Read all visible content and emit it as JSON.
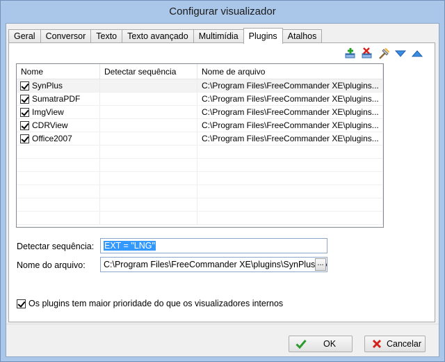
{
  "window": {
    "title": "Configurar visualizador"
  },
  "tabs": [
    {
      "label": "Geral",
      "active": false
    },
    {
      "label": "Conversor",
      "active": false
    },
    {
      "label": "Texto",
      "active": false
    },
    {
      "label": "Texto avançado",
      "active": false
    },
    {
      "label": "Multimídia",
      "active": false
    },
    {
      "label": "Plugins",
      "active": true
    },
    {
      "label": "Atalhos",
      "active": false
    }
  ],
  "toolbar": {
    "icons": [
      "add-plugin-icon",
      "remove-plugin-icon",
      "configure-plugin-icon",
      "move-down-icon",
      "move-up-icon"
    ]
  },
  "list": {
    "columns": [
      "Nome",
      "Detectar sequência",
      "Nome de arquivo"
    ],
    "rows": [
      {
        "checked": true,
        "name": "SynPlus",
        "detect": "",
        "file": "C:\\Program Files\\FreeCommander XE\\plugins..."
      },
      {
        "checked": true,
        "name": "SumatraPDF",
        "detect": "",
        "file": "C:\\Program Files\\FreeCommander XE\\plugins..."
      },
      {
        "checked": true,
        "name": "ImgView",
        "detect": "",
        "file": "C:\\Program Files\\FreeCommander XE\\plugins..."
      },
      {
        "checked": true,
        "name": "CDRView",
        "detect": "",
        "file": "C:\\Program Files\\FreeCommander XE\\plugins..."
      },
      {
        "checked": true,
        "name": "Office2007",
        "detect": "",
        "file": "C:\\Program Files\\FreeCommander XE\\plugins..."
      }
    ]
  },
  "form": {
    "detect_label": "Detectar sequência:",
    "detect_value": "EXT = \"LNG\"",
    "filename_label": "Nome do arquivo:",
    "filename_value": "C:\\Program Files\\FreeCommander XE\\plugins\\SynPlus\\Syn",
    "browse_label": "...",
    "priority_label": "Os plugins tem maior prioridade do que os visualizadores internos",
    "priority_checked": true
  },
  "buttons": {
    "ok": "OK",
    "cancel": "Cancelar"
  },
  "colors": {
    "accent": "#3399ff",
    "ok_green": "#2e9a2e",
    "cancel_red": "#d4221a",
    "arrow_blue": "#1f6fd6"
  }
}
